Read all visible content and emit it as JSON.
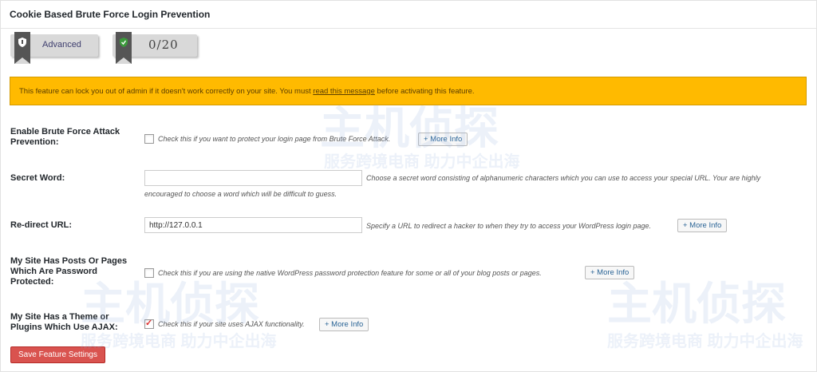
{
  "panel": {
    "title": "Cookie Based Brute Force Login Prevention"
  },
  "badges": {
    "level": "Advanced",
    "score": "0/20"
  },
  "warning": {
    "text_before": "This feature can lock you out of admin if it doesn't work correctly on your site. You must ",
    "link": "read this message",
    "text_after": " before activating this feature."
  },
  "form": {
    "enable": {
      "label": "Enable Brute Force Attack Prevention:",
      "checked": false,
      "desc": "Check this if you want to protect your login page from Brute Force Attack.",
      "more": "+ More Info"
    },
    "secret": {
      "label": "Secret Word:",
      "value": "",
      "desc_line1": "Choose a secret word consisting of alphanumeric characters which you can use to access your special URL. Your are highly",
      "desc_line2": "encouraged to choose a word which will be difficult to guess."
    },
    "redirect": {
      "label": "Re-direct URL:",
      "value": "http://127.0.0.1",
      "desc": "Specify a URL to redirect a hacker to when they try to access your WordPress login page.",
      "more": "+ More Info"
    },
    "password_protected": {
      "label": "My Site Has Posts Or Pages Which Are Password Protected:",
      "checked": false,
      "desc": "Check this if you are using the native WordPress password protection feature for some or all of your blog posts or pages.",
      "more": "+ More Info"
    },
    "ajax": {
      "label": "My Site Has a Theme or Plugins Which Use AJAX:",
      "checked": true,
      "desc": "Check this if your site uses AJAX functionality.",
      "more": "+ More Info"
    }
  },
  "save_button": "Save Feature Settings",
  "watermark": {
    "brand": "主机侦探",
    "tagline": "服务跨境电商 助力中企出海"
  }
}
